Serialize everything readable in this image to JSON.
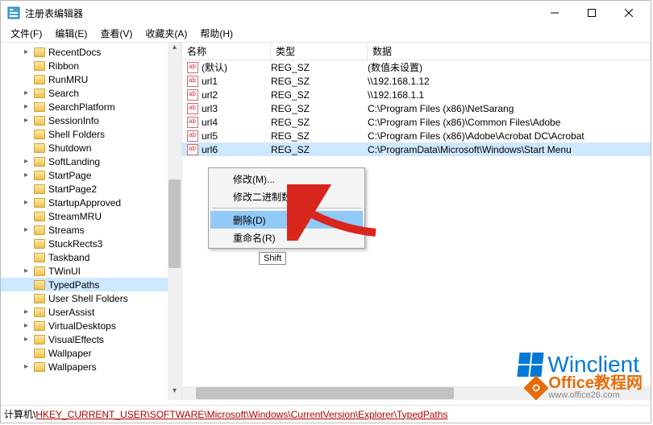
{
  "window": {
    "title": "注册表编辑器"
  },
  "menubar": [
    "文件(F)",
    "编辑(E)",
    "查看(V)",
    "收藏夹(A)",
    "帮助(H)"
  ],
  "tree": {
    "items": [
      {
        "label": "RecentDocs",
        "exp": true
      },
      {
        "label": "Ribbon"
      },
      {
        "label": "RunMRU"
      },
      {
        "label": "Search",
        "exp": true
      },
      {
        "label": "SearchPlatform",
        "exp": true
      },
      {
        "label": "SessionInfo",
        "exp": true
      },
      {
        "label": "Shell Folders"
      },
      {
        "label": "Shutdown"
      },
      {
        "label": "SoftLanding",
        "exp": true
      },
      {
        "label": "StartPage",
        "exp": true
      },
      {
        "label": "StartPage2"
      },
      {
        "label": "StartupApproved",
        "exp": true
      },
      {
        "label": "StreamMRU"
      },
      {
        "label": "Streams",
        "exp": true
      },
      {
        "label": "StuckRects3"
      },
      {
        "label": "Taskband"
      },
      {
        "label": "TWinUI",
        "exp": true
      },
      {
        "label": "TypedPaths",
        "sel": true
      },
      {
        "label": "User Shell Folders"
      },
      {
        "label": "UserAssist",
        "exp": true
      },
      {
        "label": "VirtualDesktops",
        "exp": true
      },
      {
        "label": "VisualEffects",
        "exp": true
      },
      {
        "label": "Wallpaper"
      },
      {
        "label": "Wallpapers",
        "exp": true
      }
    ]
  },
  "list": {
    "cols": {
      "name": "名称",
      "type": "类型",
      "data": "数据"
    },
    "rows": [
      {
        "name": "(默认)",
        "type": "REG_SZ",
        "data": "(数值未设置)"
      },
      {
        "name": "url1",
        "type": "REG_SZ",
        "data": "\\\\192.168.1.12"
      },
      {
        "name": "url2",
        "type": "REG_SZ",
        "data": "\\\\192.168.1.1"
      },
      {
        "name": "url3",
        "type": "REG_SZ",
        "data": "C:\\Program Files (x86)\\NetSarang"
      },
      {
        "name": "url4",
        "type": "REG_SZ",
        "data": "C:\\Program Files (x86)\\Common Files\\Adobe"
      },
      {
        "name": "url5",
        "type": "REG_SZ",
        "data": "C:\\Program Files (x86)\\Adobe\\Acrobat DC\\Acrobat"
      },
      {
        "name": "url6",
        "type": "REG_SZ",
        "data": "C:\\ProgramData\\Microsoft\\Windows\\Start Menu",
        "sel": true
      }
    ]
  },
  "context_menu": {
    "items": [
      {
        "label": "修改(M)..."
      },
      {
        "label": "修改二进制数据(B)..."
      },
      {
        "sep": true
      },
      {
        "label": "删除(D)",
        "hov": true
      },
      {
        "label": "重命名(R)"
      }
    ]
  },
  "tooltip": "Shift",
  "statusbar": {
    "prefix": "计算机\\",
    "path": "HKEY_CURRENT_USER\\SOFTWARE\\Microsoft\\Windows\\CurrentVersion\\Explorer\\TypedPaths"
  },
  "watermarks": {
    "w1": "Winclient",
    "w2": "Office教程网",
    "w3": "www.office26.com"
  }
}
